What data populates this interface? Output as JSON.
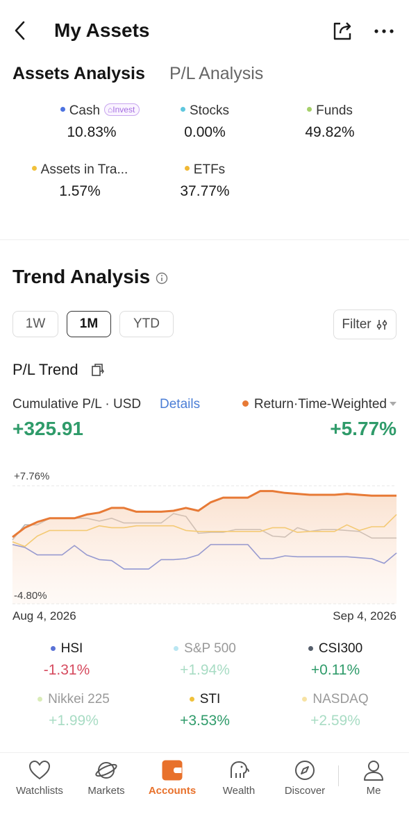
{
  "header": {
    "title": "My Assets"
  },
  "tabs": {
    "active": "Assets Analysis",
    "inactive": "P/L Analysis"
  },
  "allocation": [
    {
      "label": "Cash",
      "value": "10.83%",
      "color": "#4c72e0",
      "badge": "Invest"
    },
    {
      "label": "Stocks",
      "value": "0.00%",
      "color": "#5fc7de"
    },
    {
      "label": "Funds",
      "value": "49.82%",
      "color": "#a6d06a"
    },
    {
      "label": "Assets in Tra...",
      "value": "1.57%",
      "color": "#f1c13b"
    },
    {
      "label": "ETFs",
      "value": "37.77%",
      "color": "#f0b835"
    }
  ],
  "trend": {
    "title": "Trend Analysis",
    "ranges": [
      "1W",
      "1M",
      "YTD"
    ],
    "active_range": "1M",
    "filter_label": "Filter",
    "pl_trend_label": "P/L Trend",
    "cumulative_label": "Cumulative P/L · USD",
    "details_label": "Details",
    "return_label": "Return·Time-Weighted",
    "cumulative_value": "+325.91",
    "return_value": "+5.77%"
  },
  "chart_data": {
    "type": "line",
    "y_top_label": "+7.76%",
    "y_bottom_label": "-4.80%",
    "ylim": [
      -4.8,
      7.76
    ],
    "x_start": "Aug 4, 2026",
    "x_end": "Sep 4, 2026",
    "n_points": 32,
    "series": [
      {
        "name": "Return",
        "color": "#e77a36",
        "fill": true,
        "values": [
          2.3,
          3.3,
          3.9,
          4.3,
          4.3,
          4.3,
          4.7,
          4.9,
          5.4,
          5.4,
          5.0,
          5.0,
          5.0,
          5.1,
          5.4,
          5.1,
          6.0,
          6.5,
          6.5,
          6.5,
          7.2,
          7.2,
          7.0,
          6.9,
          6.8,
          6.8,
          6.8,
          6.9,
          6.8,
          6.7,
          6.7,
          6.7
        ]
      },
      {
        "name": "HSI",
        "color": "#5a72d6",
        "values": [
          1.5,
          1.2,
          0.4,
          0.4,
          0.4,
          1.4,
          0.4,
          -0.1,
          -0.2,
          -1.1,
          -1.1,
          -1.1,
          -0.1,
          -0.1,
          0.0,
          0.4,
          1.5,
          1.5,
          1.5,
          1.5,
          0.0,
          0.0,
          0.3,
          0.2,
          0.2,
          0.2,
          0.2,
          0.2,
          0.1,
          0.0,
          -0.5,
          0.6
        ]
      },
      {
        "name": "S&P 500",
        "color": "#b0b0b0",
        "values": [
          2.0,
          3.6,
          3.6,
          4.3,
          4.3,
          4.3,
          4.3,
          4.0,
          4.3,
          3.8,
          3.8,
          3.8,
          3.8,
          4.8,
          4.5,
          2.7,
          2.8,
          2.8,
          3.1,
          3.1,
          3.1,
          2.4,
          2.3,
          3.3,
          2.9,
          3.1,
          3.1,
          3.0,
          2.9,
          2.2,
          2.2,
          2.2
        ]
      },
      {
        "name": "STI",
        "color": "#f0c13b",
        "values": [
          1.8,
          1.3,
          2.4,
          3.0,
          3.0,
          3.0,
          3.0,
          3.5,
          3.3,
          3.3,
          3.5,
          3.5,
          3.5,
          3.5,
          3.0,
          2.9,
          2.9,
          2.9,
          2.9,
          2.9,
          2.9,
          3.3,
          3.3,
          2.8,
          2.9,
          2.9,
          2.9,
          3.6,
          3.0,
          3.4,
          3.4,
          4.7
        ]
      }
    ]
  },
  "benchmarks": [
    {
      "label": "HSI",
      "value": "-1.31%",
      "dot": "#5a72d6",
      "label_color": "#1a1a1a",
      "value_color": "#d64b5f"
    },
    {
      "label": "S&P 500",
      "value": "+1.94%",
      "dot": "#b9e6f2",
      "label_color": "#999999",
      "value_color": "#a8dcc4"
    },
    {
      "label": "CSI300",
      "value": "+0.11%",
      "dot": "#555e6b",
      "label_color": "#1a1a1a",
      "value_color": "#2f9b6a"
    },
    {
      "label": "Nikkei 225",
      "value": "+1.99%",
      "dot": "#d9ecb8",
      "label_color": "#999999",
      "value_color": "#a8dcc4"
    },
    {
      "label": "STI",
      "value": "+3.53%",
      "dot": "#f0c13b",
      "label_color": "#1a1a1a",
      "value_color": "#2f9b6a"
    },
    {
      "label": "NASDAQ",
      "value": "+2.59%",
      "dot": "#f7e2a3",
      "label_color": "#999999",
      "value_color": "#a8dcc4"
    }
  ],
  "nav": [
    {
      "label": "Watchlists",
      "icon": "heart-icon"
    },
    {
      "label": "Markets",
      "icon": "planet-icon"
    },
    {
      "label": "Accounts",
      "icon": "wallet-icon",
      "active": true
    },
    {
      "label": "Wealth",
      "icon": "elephant-icon"
    },
    {
      "label": "Discover",
      "icon": "compass-icon"
    },
    {
      "label": "Me",
      "icon": "user-icon"
    }
  ]
}
